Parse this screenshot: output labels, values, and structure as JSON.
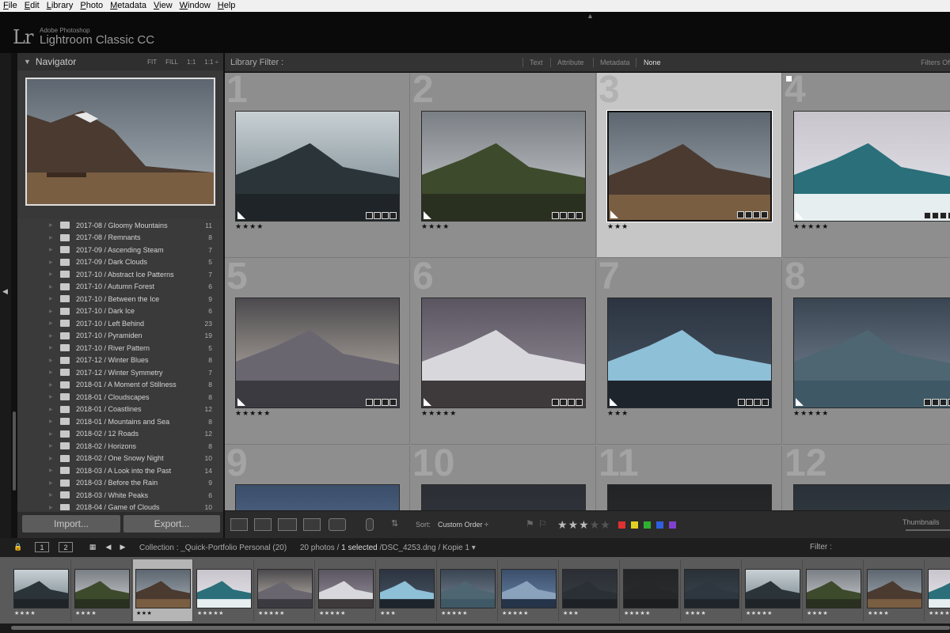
{
  "menu": [
    "File",
    "Edit",
    "Library",
    "Photo",
    "Metadata",
    "View",
    "Window",
    "Help"
  ],
  "identity": {
    "logo": "Lr",
    "vendor": "Adobe Photoshop",
    "product": "Lightroom Classic CC"
  },
  "navigator": {
    "title": "Navigator",
    "zoom": [
      "FIT",
      "FILL",
      "1:1",
      "1:1 ÷"
    ]
  },
  "folders": [
    {
      "name": "2017-08 / Gloomy Mountains",
      "count": "11"
    },
    {
      "name": "2017-08 / Remnants",
      "count": "8"
    },
    {
      "name": "2017-09 / Ascending Steam",
      "count": "7"
    },
    {
      "name": "2017-09 / Dark Clouds",
      "count": "5"
    },
    {
      "name": "2017-10 / Abstract Ice Patterns",
      "count": "7"
    },
    {
      "name": "2017-10 / Autumn Forest",
      "count": "6"
    },
    {
      "name": "2017-10 / Between the Ice",
      "count": "9"
    },
    {
      "name": "2017-10 / Dark Ice",
      "count": "6"
    },
    {
      "name": "2017-10 / Left Behind",
      "count": "23"
    },
    {
      "name": "2017-10 / Pyramiden",
      "count": "19"
    },
    {
      "name": "2017-10 / River Pattern",
      "count": "5"
    },
    {
      "name": "2017-12 / Winter Blues",
      "count": "8"
    },
    {
      "name": "2017-12 / Winter Symmetry",
      "count": "7"
    },
    {
      "name": "2018-01 / A Moment of Stillness",
      "count": "8"
    },
    {
      "name": "2018-01 / Cloudscapes",
      "count": "8"
    },
    {
      "name": "2018-01 / Coastlines",
      "count": "12"
    },
    {
      "name": "2018-01 / Mountains and Sea",
      "count": "8"
    },
    {
      "name": "2018-02 / 12 Roads",
      "count": "12"
    },
    {
      "name": "2018-02 / Horizons",
      "count": "8"
    },
    {
      "name": "2018-02 / One Snowy Night",
      "count": "10"
    },
    {
      "name": "2018-03 / A Look into the Past",
      "count": "14"
    },
    {
      "name": "2018-03 / Before the Rain",
      "count": "9"
    },
    {
      "name": "2018-03 / White Peaks",
      "count": "6"
    },
    {
      "name": "2018-04 / Game of Clouds",
      "count": "10"
    }
  ],
  "buttons": {
    "import": "Import...",
    "export": "Export..."
  },
  "filter_bar": {
    "label": "Library Filter :",
    "tabs": [
      "Text",
      "Attribute",
      "Metadata",
      "None"
    ],
    "filters_off": "Filters Off"
  },
  "grid_cells": [
    {
      "num": "1",
      "stars": "★★★★"
    },
    {
      "num": "2",
      "stars": "★★★★"
    },
    {
      "num": "3",
      "stars": "★★★",
      "selected": true
    },
    {
      "num": "4",
      "stars": "★★★★★"
    },
    {
      "num": "5",
      "stars": "★★★★★"
    },
    {
      "num": "6",
      "stars": "★★★★★"
    },
    {
      "num": "7",
      "stars": "★★★"
    },
    {
      "num": "8",
      "stars": "★★★★★"
    },
    {
      "num": "9",
      "stars": ""
    },
    {
      "num": "10",
      "stars": ""
    },
    {
      "num": "11",
      "stars": ""
    },
    {
      "num": "12",
      "stars": ""
    }
  ],
  "toolbar": {
    "sort_label": "Sort:",
    "sort_value": "Custom Order ÷",
    "rating": 3,
    "rating_max": 5,
    "thumbnails_label": "Thumbnails",
    "color_labels": [
      "#e03030",
      "#e0d020",
      "#30b030",
      "#3060e0",
      "#8040d0"
    ]
  },
  "filmstrip_header": {
    "page1": "1",
    "page2": "2",
    "source_prefix": "Collection : _Quick-Portfolio Personal (20)",
    "photos": "20 photos /",
    "selected": "1 selected",
    "file": "/DSC_4253.dng / Kopie 1 ▾",
    "filter_label": "Filter :"
  },
  "filmstrip_stars": [
    "★★★★",
    "★★★★",
    "★★★",
    "★★★★★",
    "★★★★★",
    "★★★★★",
    "★★★",
    "★★★★★",
    "★★★★★",
    "★★★",
    "★★★★★",
    "★★★★",
    "★★★★★",
    "★★★★",
    "★★★★",
    "★★★★"
  ],
  "colors": {
    "accent_selected": "#c6c6c6",
    "grid_bg": "#8e8e8e",
    "panel_bg": "#383838"
  }
}
